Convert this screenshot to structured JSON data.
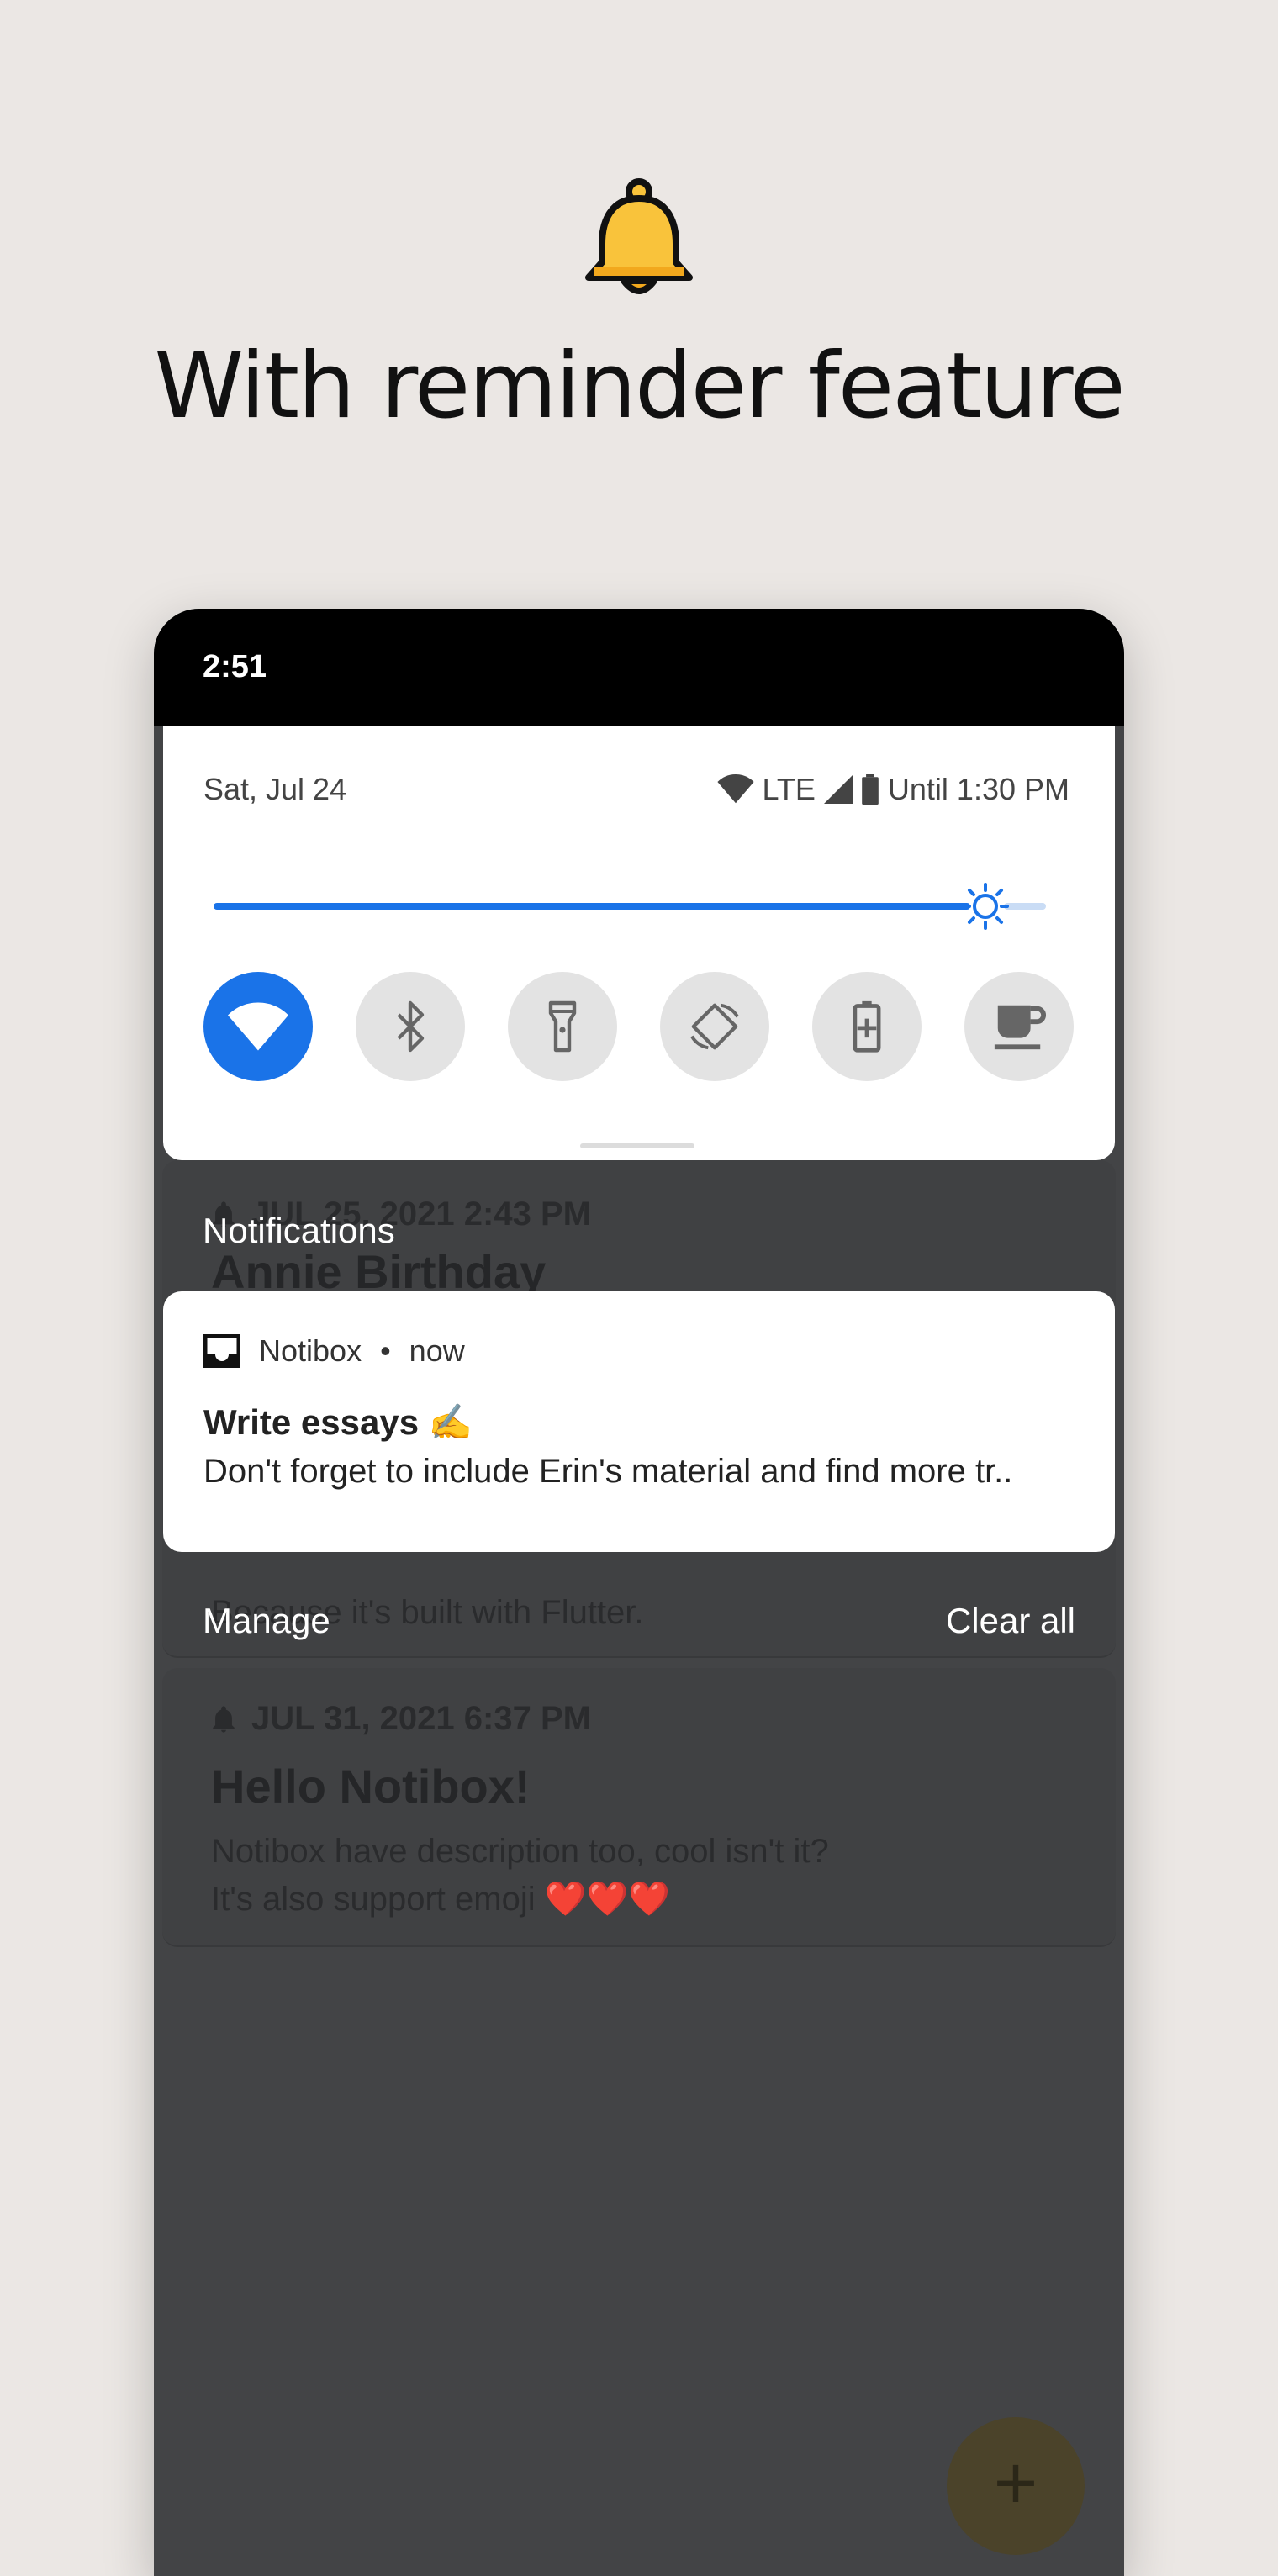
{
  "headline": "With reminder feature",
  "status_bar": {
    "time": "2:51"
  },
  "quick_settings": {
    "date": "Sat, Jul 24",
    "network": "LTE",
    "battery_text": "Until 1:30 PM",
    "brightness_level": 0.9,
    "tiles": [
      {
        "name": "wifi",
        "on": true
      },
      {
        "name": "bluetooth",
        "on": false
      },
      {
        "name": "flashlight",
        "on": false
      },
      {
        "name": "auto-rotate",
        "on": false
      },
      {
        "name": "battery-saver",
        "on": false
      },
      {
        "name": "caffeine",
        "on": false
      }
    ]
  },
  "notifications": {
    "header": "Notifications",
    "item": {
      "app_name": "Notibox",
      "time": "now",
      "title": "Write essays ✍️",
      "body": "Don't forget to include Erin's material and find more tr.."
    },
    "manage_label": "Manage",
    "clear_label": "Clear all"
  },
  "app_list": {
    "cards": [
      {
        "date": "JUL 25, 2021 2:43 PM",
        "title": "Annie Birthday",
        "description": "Because it's built with Flutter."
      },
      {
        "date": "JUL 31, 2021 6:37 PM",
        "title": "Hello Notibox!",
        "description_line1": "Notibox have description too, cool isn't it?",
        "description_line2": "It's also support emoji ❤️❤️❤️"
      }
    ],
    "fab_label": "+"
  },
  "colors": {
    "accent": "#1a73e8",
    "bell": "#f9c33b",
    "background": "#ebe7e4"
  }
}
